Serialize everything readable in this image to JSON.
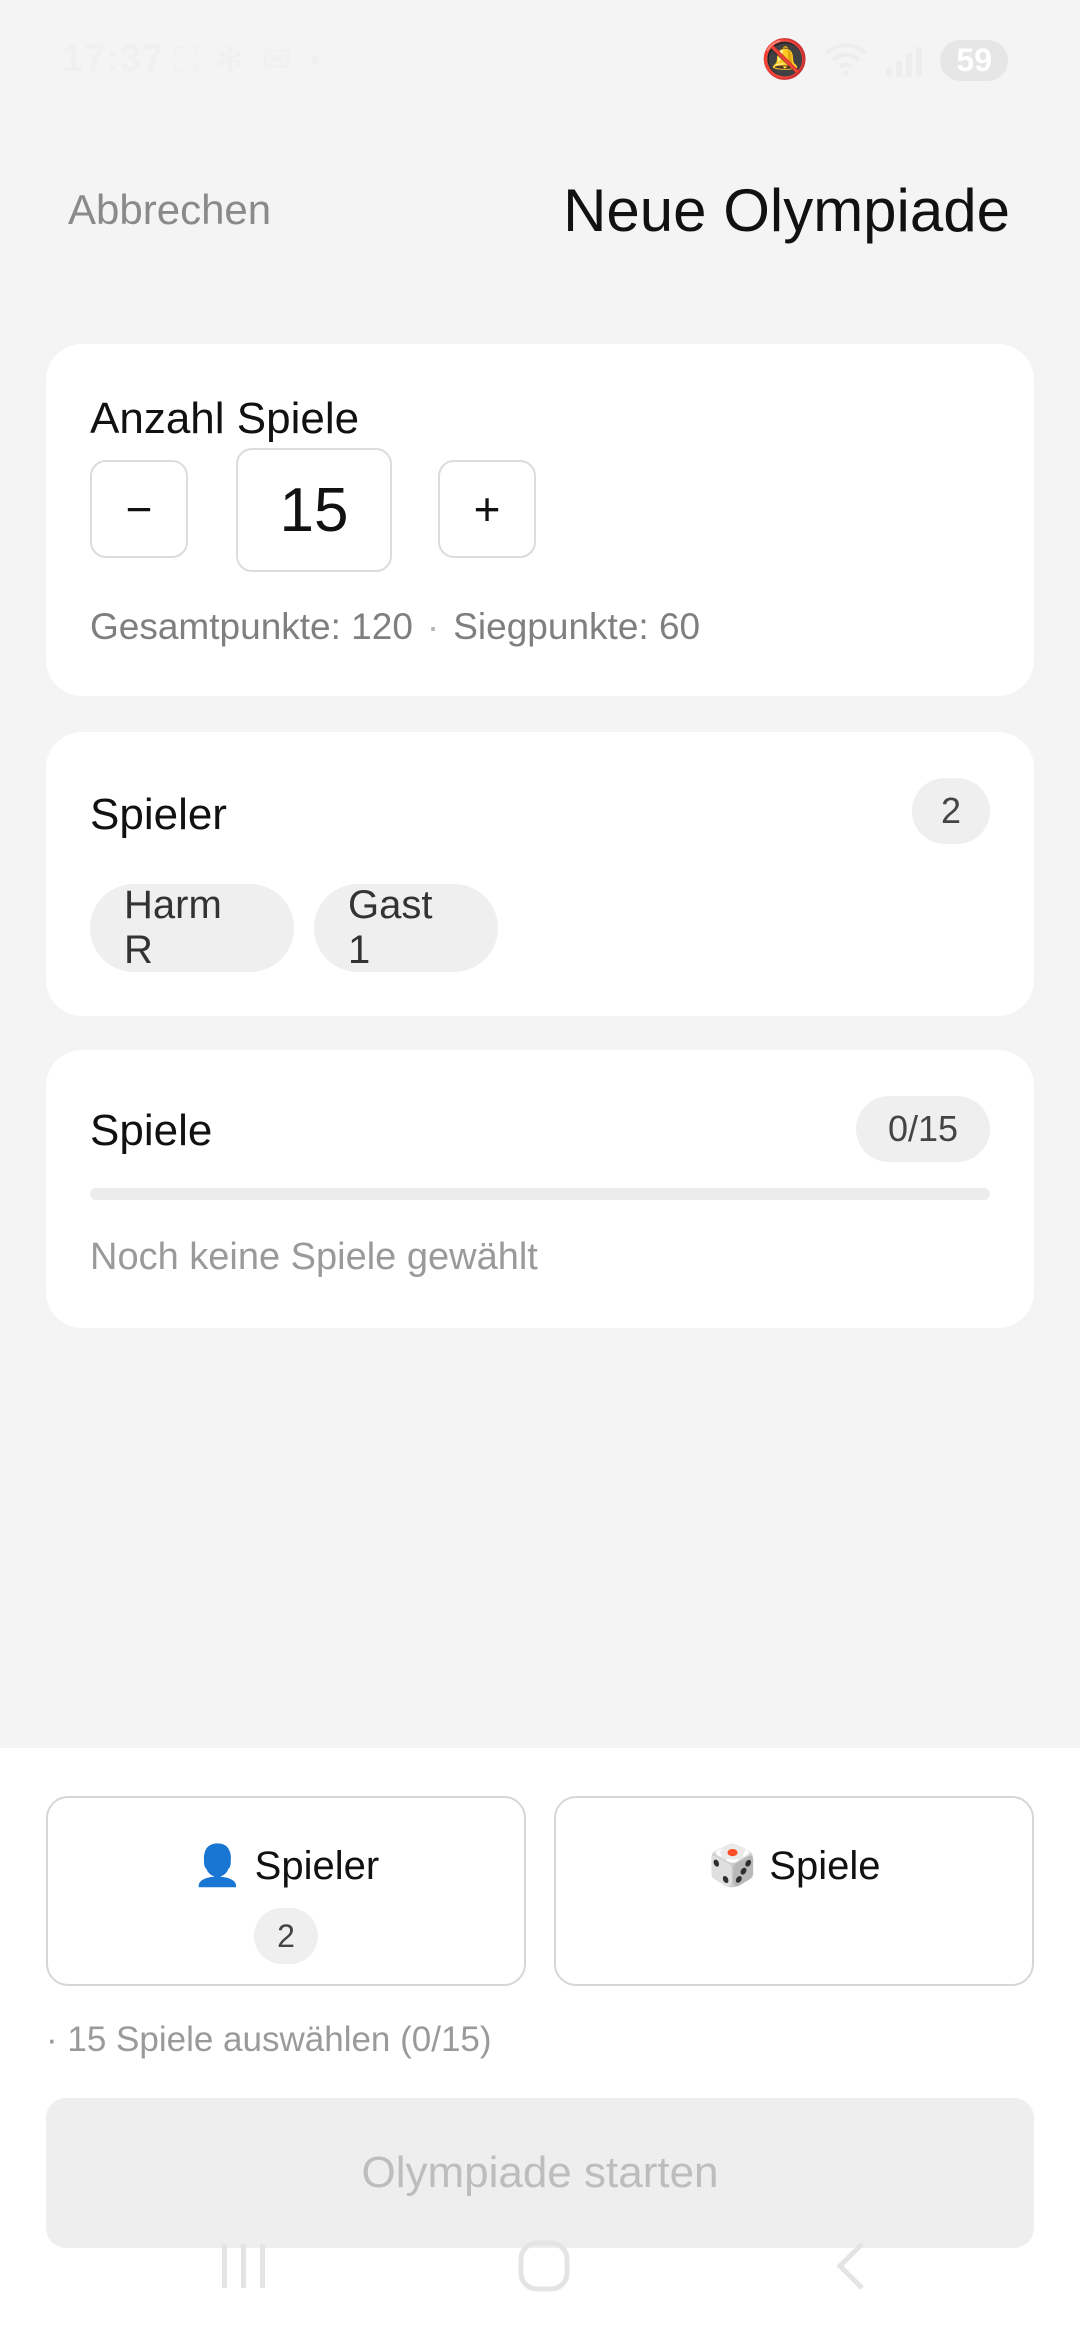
{
  "status_bar": {
    "time": "17:37",
    "battery": "59",
    "left_icons": [
      "screenshot-icon",
      "pinwheel-icon",
      "mail-icon",
      "dot-icon"
    ],
    "right_icons": [
      "mute-icon",
      "wifi-icon",
      "signal-icon"
    ]
  },
  "header": {
    "cancel_label": "Abbrechen",
    "title": "Neue Olympiade"
  },
  "count_card": {
    "heading": "Anzahl Spiele",
    "minus_label": "−",
    "plus_label": "+",
    "value": "15",
    "total_points": "Gesamtpunkte: 120",
    "separator": "·",
    "win_points": "Siegpunkte: 60"
  },
  "players_card": {
    "heading": "Spieler",
    "count": "2",
    "players": [
      "Harm R",
      "Gast 1"
    ]
  },
  "games_card": {
    "heading": "Spiele",
    "count": "0/15",
    "progress": 0,
    "empty_text": "Noch keine Spiele gewählt"
  },
  "bottom": {
    "players_button": {
      "emoji": "👤",
      "label": "Spieler",
      "count": "2"
    },
    "games_button": {
      "emoji": "🎲",
      "label": "Spiele"
    },
    "hint": "· 15 Spiele auswählen (0/15)",
    "start_label": "Olympiade starten"
  },
  "nav": {
    "recents_icon": "recents-icon",
    "home_icon": "home-icon",
    "back_icon": "back-icon"
  }
}
